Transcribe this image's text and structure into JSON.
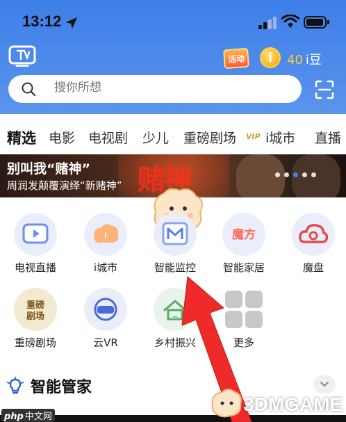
{
  "status_bar": {
    "time": "13:12"
  },
  "header": {
    "activity_badge": "活动",
    "coin_symbol": "i",
    "coin_count": "40",
    "coin_unit": "i豆"
  },
  "search": {
    "placeholder": "搜你所想"
  },
  "tabs": [
    "精选",
    "电影",
    "电视剧",
    "少儿",
    "重磅剧场",
    "i城市",
    "直播"
  ],
  "vip_tag": "VIP",
  "banner": {
    "title": "别叫我“赌神”",
    "subtitle": "周润发颠覆演绎“新赌神”",
    "art_text": "赌神",
    "active_dot": 2
  },
  "grid": [
    {
      "label": "电视直播",
      "icon": "tv-live-icon",
      "color": "#6d8df0"
    },
    {
      "label": "i城市",
      "icon": "icity-icon",
      "color": "#ff8a3c"
    },
    {
      "label": "智能监控",
      "icon": "monitor-icon",
      "color": "#5a7cf0"
    },
    {
      "label": "智能家居",
      "icon": "smart-home-icon",
      "color": "#ff6a5a"
    },
    {
      "label": "魔盘",
      "icon": "cloud-disk-icon",
      "color": "#e84a4a"
    },
    {
      "label": "重磅剧场",
      "icon": "theater-icon",
      "color": "#b8860b"
    },
    {
      "label": "云VR",
      "icon": "vr-icon",
      "color": "#4a6ad8"
    },
    {
      "label": "乡村振兴",
      "icon": "village-icon",
      "color": "#5aa86a"
    },
    {
      "label": "更多",
      "icon": "more-icon",
      "color": "#aaaaaa"
    }
  ],
  "section": {
    "title": "智能管家"
  },
  "watermarks": {
    "php_text": "php",
    "php_cn": "中文网",
    "brand": "3DMGAME"
  },
  "colors": {
    "header_blue": "#3e7fe8",
    "arrow_red": "#ee2a2a",
    "coin_gold": "#ffce3a"
  }
}
